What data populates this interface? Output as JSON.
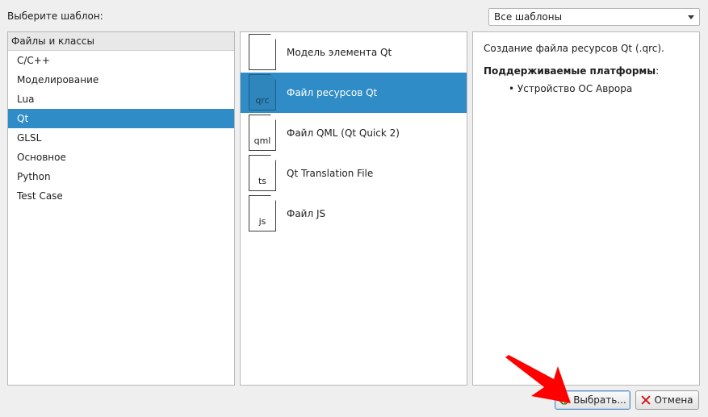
{
  "prompt_label": "Выберите шаблон:",
  "filter": {
    "selected": "Все шаблоны"
  },
  "categories": {
    "header": "Файлы и классы",
    "items": [
      {
        "label": "C/C++",
        "selected": false
      },
      {
        "label": "Моделирование",
        "selected": false
      },
      {
        "label": "Lua",
        "selected": false
      },
      {
        "label": "Qt",
        "selected": true
      },
      {
        "label": "GLSL",
        "selected": false
      },
      {
        "label": "Основное",
        "selected": false
      },
      {
        "label": "Python",
        "selected": false
      },
      {
        "label": "Test Case",
        "selected": false
      }
    ]
  },
  "templates": {
    "items": [
      {
        "label": "Модель элемента Qt",
        "ext": "",
        "selected": false
      },
      {
        "label": "Файл ресурсов Qt",
        "ext": "qrc",
        "selected": true
      },
      {
        "label": "Файл QML (Qt Quick 2)",
        "ext": "qml",
        "selected": false
      },
      {
        "label": "Qt Translation File",
        "ext": "ts",
        "selected": false
      },
      {
        "label": "Файл JS",
        "ext": "js",
        "selected": false
      }
    ]
  },
  "description": {
    "title": "Создание файла ресурсов Qt (.qrc).",
    "platforms_label": "Поддерживаемые платформы",
    "platforms_colon": ":",
    "platforms": [
      "Устройство ОС Аврора"
    ]
  },
  "buttons": {
    "choose_label": "Выбрать...",
    "cancel_label": "Отмена"
  },
  "colors": {
    "selection": "#308cc6",
    "annotation_arrow": "#ff0000"
  }
}
